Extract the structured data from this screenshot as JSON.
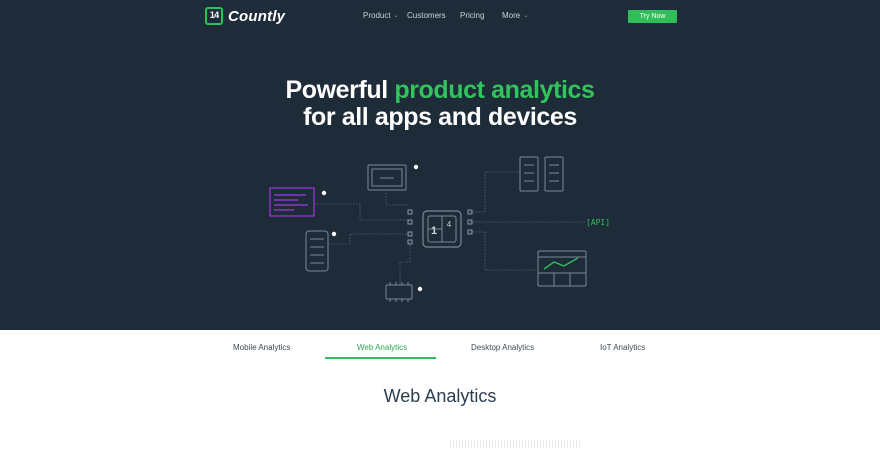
{
  "brand": {
    "name": "Countly",
    "mark_text": "14",
    "accent": "#2fbf5a",
    "hero_bg": "#1e2b38"
  },
  "nav": {
    "items": [
      {
        "label": "Product",
        "has_dropdown": true
      },
      {
        "label": "Customers",
        "has_dropdown": false
      },
      {
        "label": "Pricing",
        "has_dropdown": false
      },
      {
        "label": "More",
        "has_dropdown": true
      }
    ],
    "cta_label": "Try Now"
  },
  "hero": {
    "headline_part1": "Powerful ",
    "headline_highlight": "product analytics",
    "headline_line2": "for all apps and devices",
    "api_label": "[API]",
    "center_mark_text": "14"
  },
  "tabs": {
    "items": [
      {
        "label": "Mobile Analytics",
        "active": false
      },
      {
        "label": "Web Analytics",
        "active": true
      },
      {
        "label": "Desktop Analytics",
        "active": false
      },
      {
        "label": "IoT Analytics",
        "active": false
      }
    ]
  },
  "section": {
    "title": "Web Analytics"
  }
}
